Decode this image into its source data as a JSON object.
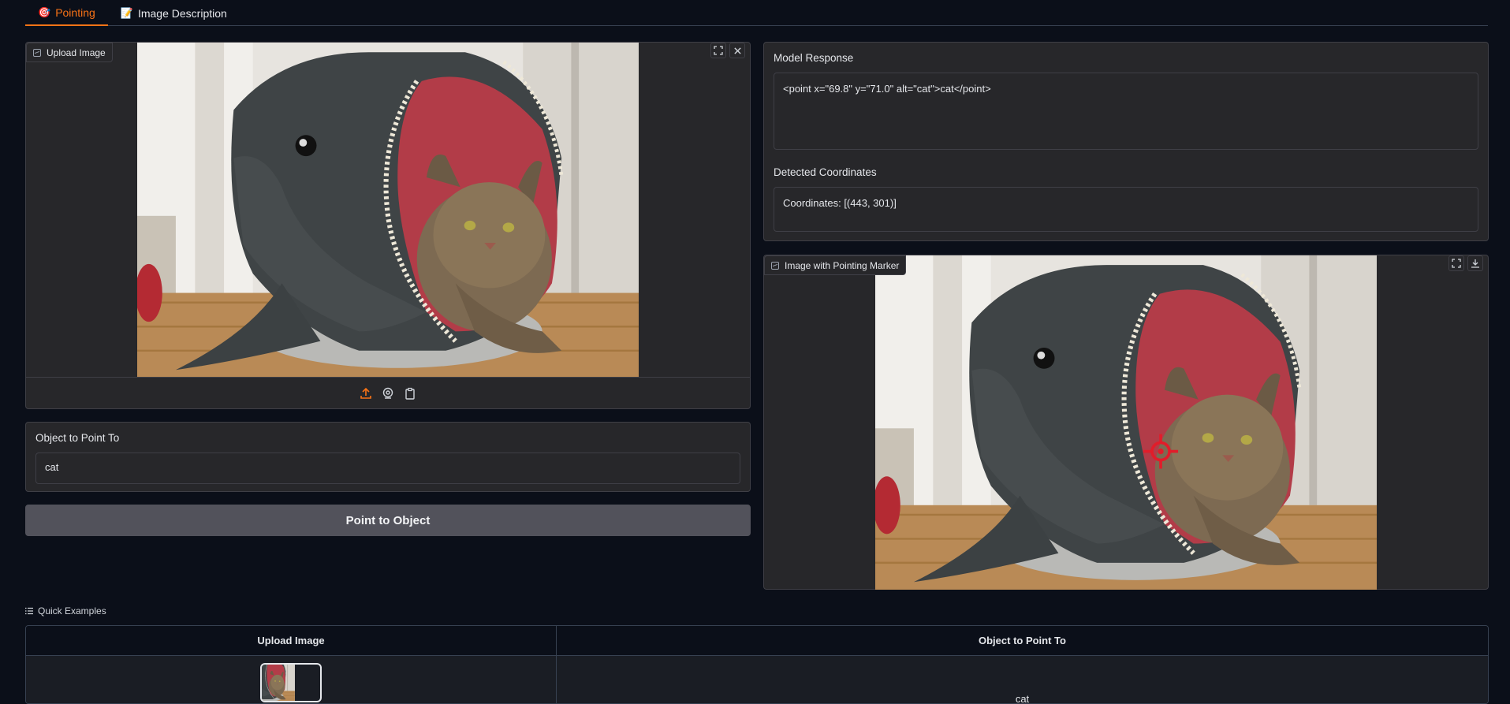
{
  "tabs": [
    {
      "icon": "🎯",
      "label": "Pointing",
      "active": true
    },
    {
      "icon": "📝",
      "label": "Image Description",
      "active": false
    }
  ],
  "upload": {
    "label": "Upload Image"
  },
  "object_field": {
    "label": "Object to Point To",
    "value": "cat"
  },
  "submit_label": "Point to Object",
  "model_response": {
    "label": "Model Response",
    "value": "<point x=\"69.8\" y=\"71.0\" alt=\"cat\">cat</point>"
  },
  "coordinates": {
    "label": "Detected Coordinates",
    "value": "Coordinates: [(443, 301)]"
  },
  "result_image": {
    "label": "Image with Pointing Marker"
  },
  "examples": {
    "title": "Quick Examples",
    "headers": [
      "Upload Image",
      "Object to Point To"
    ],
    "rows": [
      {
        "object": "cat"
      }
    ]
  },
  "colors": {
    "accent": "#f97316",
    "background": "#0b0f19",
    "panel": "#27272a",
    "marker": "#e11d2a"
  }
}
